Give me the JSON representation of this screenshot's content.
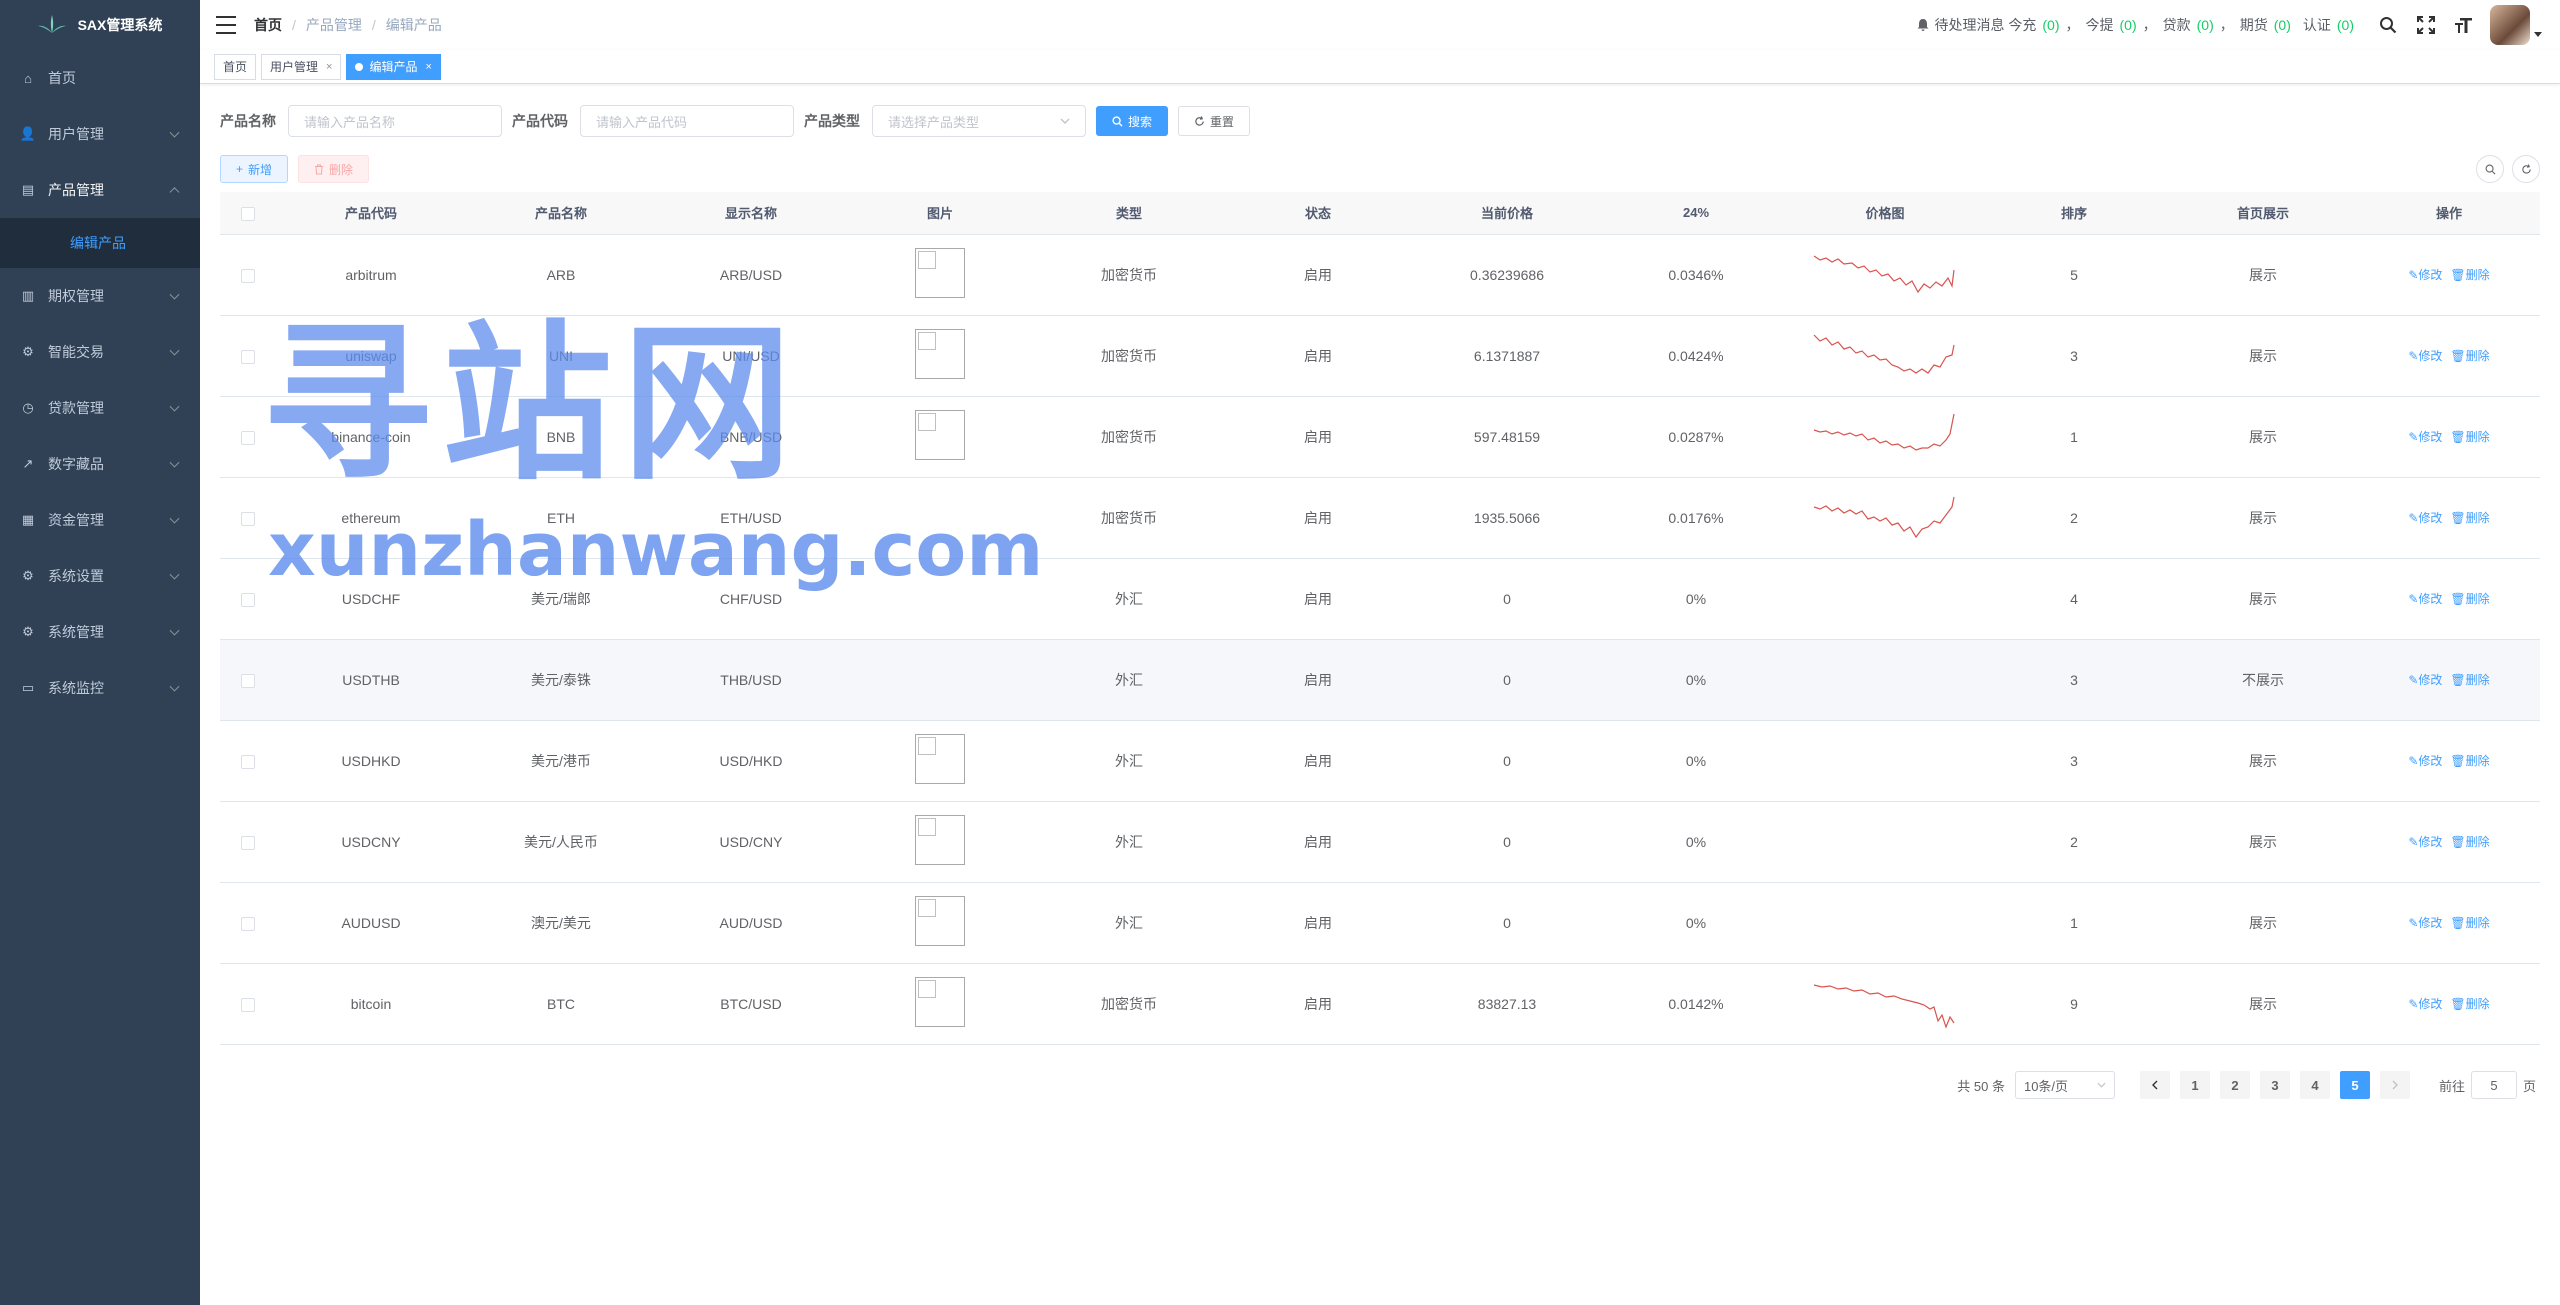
{
  "app": {
    "title": "SAX管理系统"
  },
  "sidebar": {
    "items": [
      {
        "label": "首页",
        "icon": "home-icon",
        "has_children": false
      },
      {
        "label": "用户管理",
        "icon": "user-icon",
        "has_children": true
      },
      {
        "label": "产品管理",
        "icon": "product-icon",
        "has_children": true,
        "expanded": true
      },
      {
        "label": "期权管理",
        "icon": "options-icon",
        "has_children": true
      },
      {
        "label": "智能交易",
        "icon": "smart-trade-icon",
        "has_children": true
      },
      {
        "label": "贷款管理",
        "icon": "loan-icon",
        "has_children": true
      },
      {
        "label": "数字藏品",
        "icon": "nft-icon",
        "has_children": true
      },
      {
        "label": "资金管理",
        "icon": "funds-icon",
        "has_children": true
      },
      {
        "label": "系统设置",
        "icon": "settings-icon",
        "has_children": true
      },
      {
        "label": "系统管理",
        "icon": "system-icon",
        "has_children": true
      },
      {
        "label": "系统监控",
        "icon": "monitor-icon",
        "has_children": true
      }
    ],
    "active_sub": "编辑产品"
  },
  "header": {
    "breadcrumb": [
      "首页",
      "产品管理",
      "编辑产品"
    ],
    "pending_label": "待处理消息 今充",
    "pending_count": "(0)",
    "comma": "，",
    "withdraw_label": "今提",
    "withdraw_count": "(0)",
    "loan_label": "贷款",
    "loan_count": "(0)",
    "futures_label": "期货",
    "futures_count": "(0)",
    "verify_label": "认证",
    "verify_count": "(0)"
  },
  "tags": {
    "home": "首页",
    "user": "用户管理",
    "user_close": "×",
    "active": "编辑产品",
    "active_close": "×"
  },
  "search": {
    "name_label": "产品名称",
    "name_placeholder": "请输入产品名称",
    "code_label": "产品代码",
    "code_placeholder": "请输入产品代码",
    "type_label": "产品类型",
    "type_placeholder": "请选择产品类型",
    "search_btn": "搜索",
    "reset_btn": "重置"
  },
  "toolbar": {
    "add_btn": "新增",
    "delete_btn": "删除"
  },
  "table": {
    "headers": [
      "产品代码",
      "产品名称",
      "显示名称",
      "图片",
      "类型",
      "状态",
      "当前价格",
      "24%",
      "价格图",
      "排序",
      "首页展示",
      "操作"
    ],
    "edit_label": "修改",
    "delete_label": "删除",
    "rows": [
      {
        "code": "arbitrum",
        "name": "ARB",
        "display": "ARB/USD",
        "has_img": true,
        "type": "加密货币",
        "status": "启用",
        "price": "0.36239686",
        "change": "0.0346%",
        "red": true,
        "spark": "a",
        "sort": "5",
        "home": "展示"
      },
      {
        "code": "uniswap",
        "name": "UNI",
        "display": "UNI/USD",
        "has_img": true,
        "type": "加密货币",
        "status": "启用",
        "price": "6.1371887",
        "change": "0.0424%",
        "red": true,
        "spark": "b",
        "sort": "3",
        "home": "展示"
      },
      {
        "code": "binance-coin",
        "name": "BNB",
        "display": "BNB/USD",
        "has_img": true,
        "type": "加密货币",
        "status": "启用",
        "price": "597.48159",
        "change": "0.0287%",
        "red": true,
        "spark": "c",
        "sort": "1",
        "home": "展示"
      },
      {
        "code": "ethereum",
        "name": "ETH",
        "display": "ETH/USD",
        "has_img": false,
        "type": "加密货币",
        "status": "启用",
        "price": "1935.5066",
        "change": "0.0176%",
        "red": true,
        "spark": "d",
        "sort": "2",
        "home": "展示"
      },
      {
        "code": "USDCHF",
        "name": "美元/瑞郎",
        "display": "CHF/USD",
        "has_img": false,
        "type": "外汇",
        "status": "启用",
        "price": "0",
        "change": "0%",
        "red": false,
        "spark": "",
        "sort": "4",
        "home": "展示"
      },
      {
        "code": "USDTHB",
        "name": "美元/泰铢",
        "display": "THB/USD",
        "has_img": false,
        "type": "外汇",
        "status": "启用",
        "price": "0",
        "change": "0%",
        "red": false,
        "spark": "",
        "sort": "3",
        "home": "不展示"
      },
      {
        "code": "USDHKD",
        "name": "美元/港币",
        "display": "USD/HKD",
        "has_img": true,
        "type": "外汇",
        "status": "启用",
        "price": "0",
        "change": "0%",
        "red": false,
        "spark": "",
        "sort": "3",
        "home": "展示"
      },
      {
        "code": "USDCNY",
        "name": "美元/人民币",
        "display": "USD/CNY",
        "has_img": true,
        "type": "外汇",
        "status": "启用",
        "price": "0",
        "change": "0%",
        "red": false,
        "spark": "",
        "sort": "2",
        "home": "展示"
      },
      {
        "code": "AUDUSD",
        "name": "澳元/美元",
        "display": "AUD/USD",
        "has_img": true,
        "type": "外汇",
        "status": "启用",
        "price": "0",
        "change": "0%",
        "red": false,
        "spark": "",
        "sort": "1",
        "home": "展示"
      },
      {
        "code": "bitcoin",
        "name": "BTC",
        "display": "BTC/USD",
        "has_img": true,
        "type": "加密货币",
        "status": "启用",
        "price": "83827.13",
        "change": "0.0142%",
        "red": true,
        "spark": "e",
        "sort": "9",
        "home": "展示"
      }
    ]
  },
  "pagination": {
    "total": "共 50 条",
    "page_size": "10条/页",
    "pages": [
      "1",
      "2",
      "3",
      "4",
      "5"
    ],
    "current": "5",
    "goto_label": "前往",
    "goto_value": "5",
    "page_unit": "页"
  },
  "watermark": {
    "big": "寻站网",
    "small": "xunzhanwang.com"
  },
  "colors": {
    "sidebar_bg": "#304156",
    "primary": "#409eff",
    "danger_text": "#cc0000",
    "spark_line": "#d9534f"
  }
}
